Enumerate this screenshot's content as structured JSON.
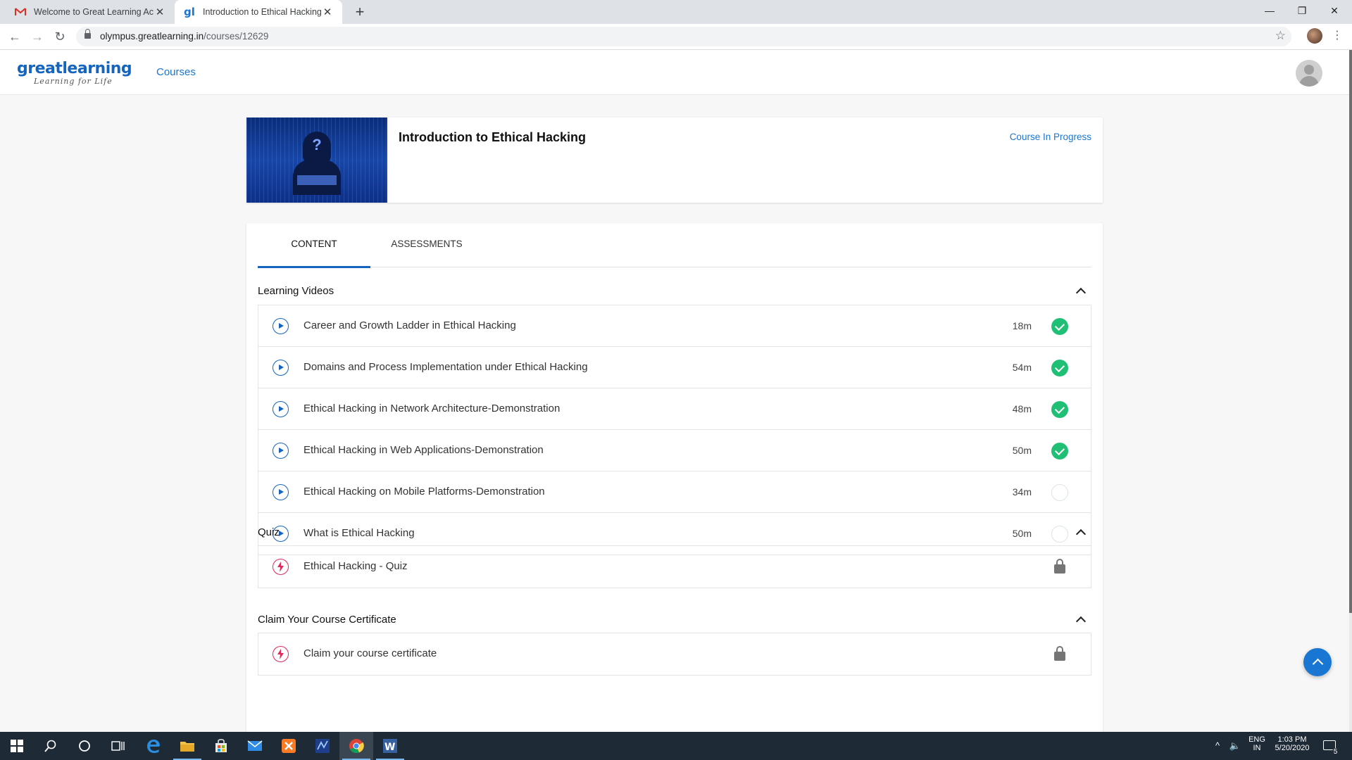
{
  "browser": {
    "tabs": [
      {
        "title": "Welcome to Great Learning Acad",
        "favicon": "gmail-icon",
        "active": false
      },
      {
        "title": "Introduction to Ethical Hacking -",
        "favicon": "greatlearning-icon",
        "active": true
      }
    ],
    "url_host": "olympus.greatlearning.in",
    "url_path": "/courses/12629"
  },
  "site": {
    "logo_text": "greatlearning",
    "logo_tagline": "Learning for Life",
    "nav_courses": "Courses"
  },
  "course": {
    "title": "Introduction to Ethical Hacking",
    "status": "Course In Progress"
  },
  "content_tabs": [
    "CONTENT",
    "ASSESSMENTS"
  ],
  "sections": {
    "videos": {
      "title": "Learning Videos",
      "items": [
        {
          "title": "Career and Growth Ladder in Ethical Hacking",
          "duration": "18m",
          "completed": true
        },
        {
          "title": "Domains and Process Implementation under Ethical Hacking",
          "duration": "54m",
          "completed": true
        },
        {
          "title": "Ethical Hacking in Network Architecture-Demonstration",
          "duration": "48m",
          "completed": true
        },
        {
          "title": "Ethical Hacking in Web Applications-Demonstration",
          "duration": "50m",
          "completed": true
        },
        {
          "title": "Ethical Hacking on Mobile Platforms-Demonstration",
          "duration": "34m",
          "completed": false
        },
        {
          "title": "What is Ethical Hacking",
          "duration": "50m",
          "completed": false
        }
      ]
    },
    "quiz": {
      "title": "Quiz",
      "items": [
        {
          "title": "Ethical Hacking - Quiz",
          "locked": true
        }
      ]
    },
    "certificate": {
      "title": "Claim Your Course Certificate",
      "items": [
        {
          "title": "Claim your course certificate",
          "locked": true
        }
      ]
    }
  },
  "taskbar": {
    "lang_top": "ENG",
    "lang_bottom": "IN",
    "time": "1:03 PM",
    "date": "5/20/2020",
    "notifications": "5"
  },
  "colors": {
    "accent": "#1565c0",
    "link": "#1976d2",
    "complete": "#1fbf75",
    "quiz_icon": "#e4285a"
  }
}
